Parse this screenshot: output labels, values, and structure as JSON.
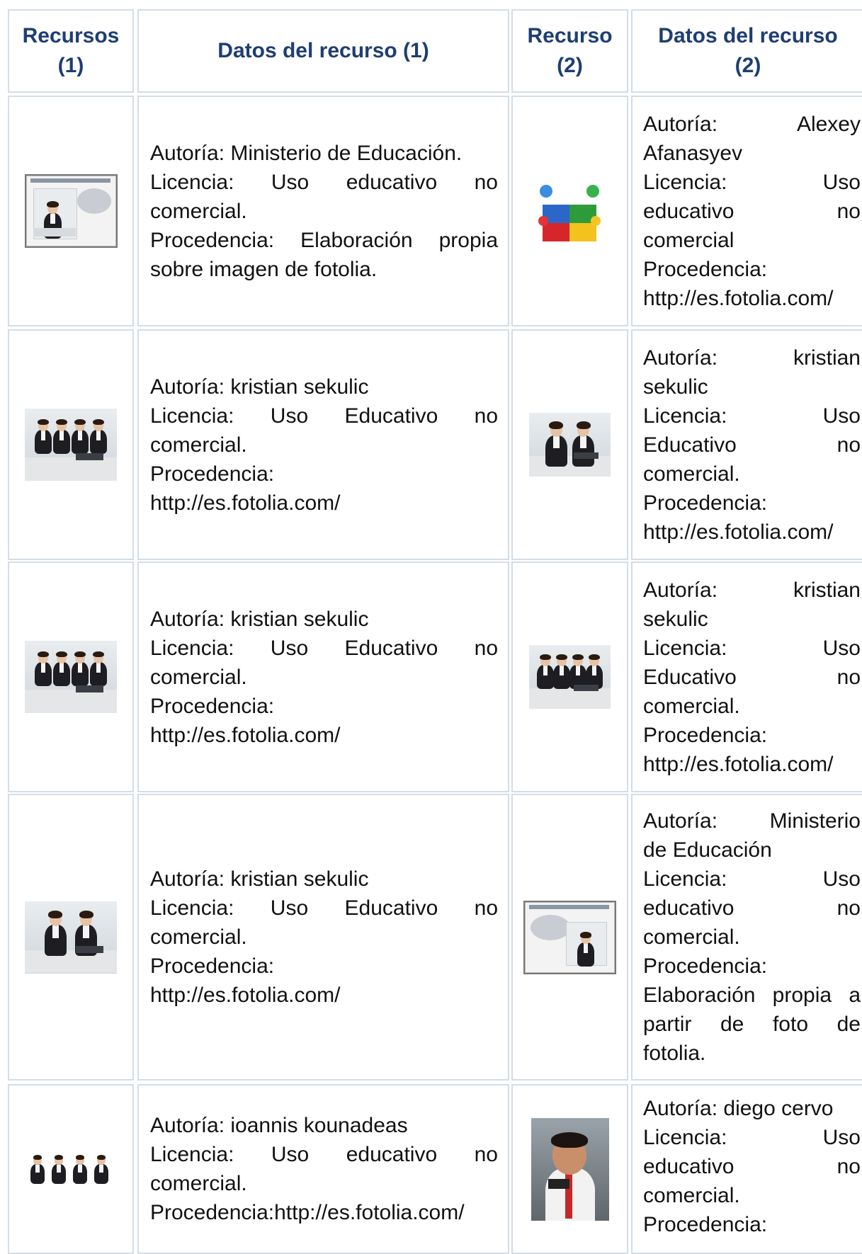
{
  "headers": [
    "Recursos\n(1)",
    "Datos del recurso (1)",
    "Recurso\n(2)",
    "Datos del recurso\n(2)"
  ],
  "rows": [
    {
      "left_image": "slide-trabajo-equipo-thumbnail",
      "left_lines": [
        "Autoría: Ministerio de Educación.",
        "Licencia: Uso educativo no",
        "comercial.",
        "Procedencia: Elaboración propia",
        "sobre imagen de fotolia."
      ],
      "right_image": "puzzle-figures-thumbnail",
      "right_lines": [
        "Autoría: Alexey",
        "Afanasyev",
        "Licencia: Uso",
        "educativo no",
        "comercial",
        "Procedencia:",
        "http://es.fotolia.com/"
      ]
    },
    {
      "left_image": "office-team-laptop-photo",
      "left_lines": [
        "Autoría: kristian sekulic",
        "Licencia: Uso Educativo no",
        "comercial.",
        "Procedencia:",
        "http://es.fotolia.com/"
      ],
      "right_image": "two-people-meeting-photo",
      "right_lines": [
        "Autoría: kristian",
        "sekulic",
        "Licencia: Uso",
        "Educativo no",
        "comercial.",
        "Procedencia:",
        "http://es.fotolia.com/"
      ]
    },
    {
      "left_image": "business-team-table-photo",
      "left_lines": [
        "Autoría: kristian sekulic",
        "Licencia: Uso Educativo no",
        "comercial.",
        "Procedencia:",
        "http://es.fotolia.com/"
      ],
      "right_image": "office-meeting-photo",
      "right_lines": [
        "Autoría: kristian",
        "sekulic",
        "Licencia: Uso",
        "Educativo no",
        "comercial.",
        "Procedencia:",
        "http://es.fotolia.com/"
      ]
    },
    {
      "left_image": "businesswoman-laptop-photo",
      "left_lines": [
        "Autoría: kristian sekulic",
        "Licencia: Uso Educativo no",
        "comercial.",
        "Procedencia:",
        "http://es.fotolia.com/"
      ],
      "right_image": "slide-stressed-woman-thumbnail",
      "right_lines": [
        "Autoría: Ministerio",
        "de Educación",
        "Licencia: Uso",
        "educativo no",
        "comercial.",
        "Procedencia:",
        "Elaboración propia a",
        "partir de foto de",
        "fotolia."
      ]
    },
    {
      "left_image": "four-people-sitting-photo",
      "left_lines": [
        "Autoría: ioannis kounadeas",
        "Licencia: Uso educativo no",
        "comercial.",
        "Procedencia:http://es.fotolia.com/"
      ],
      "right_image": "stressed-man-phone-photo",
      "right_lines": [
        "Autoría: diego cervo",
        "Licencia: Uso",
        "educativo no",
        "comercial.",
        "Procedencia:"
      ]
    }
  ]
}
